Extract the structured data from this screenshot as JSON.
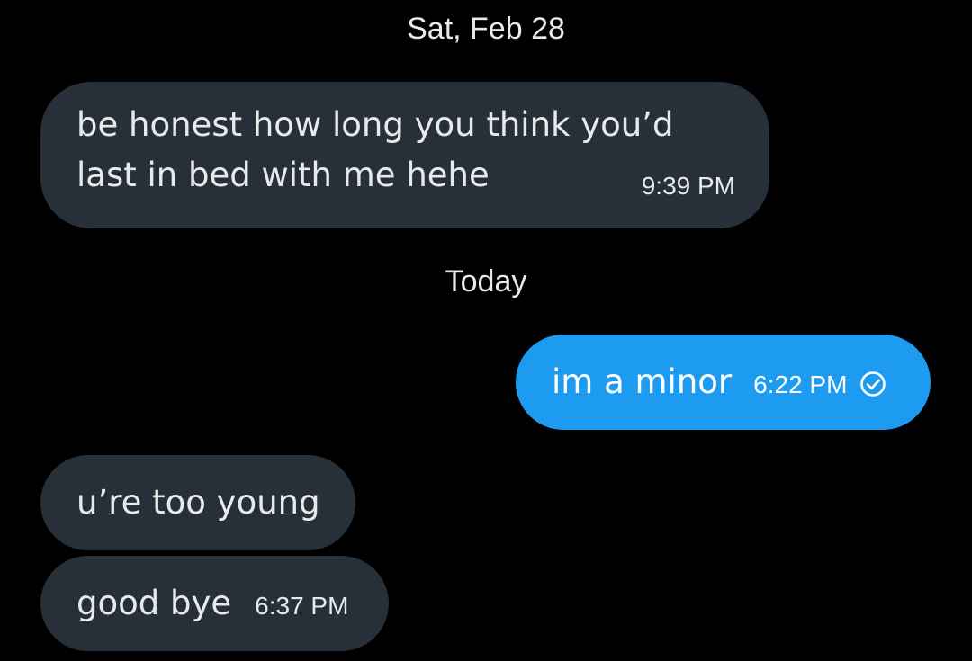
{
  "thread": {
    "separators": [
      "Sat, Feb 28",
      "Today"
    ],
    "messages": [
      {
        "direction": "incoming",
        "text": "be honest how long you think you’d\nlast in bed with me hehe",
        "time": "9:39 PM"
      },
      {
        "direction": "outgoing",
        "text": "im a minor",
        "time": "6:22 PM",
        "status_icon": "check-circle-icon"
      },
      {
        "direction": "incoming",
        "text": "u’re too young"
      },
      {
        "direction": "incoming",
        "text": "good bye",
        "time": "6:37 PM"
      }
    ]
  },
  "colors": {
    "background": "#000000",
    "incoming_bubble": "#273038",
    "outgoing_bubble": "#1d9bf0",
    "text": "#e7e9ea"
  }
}
